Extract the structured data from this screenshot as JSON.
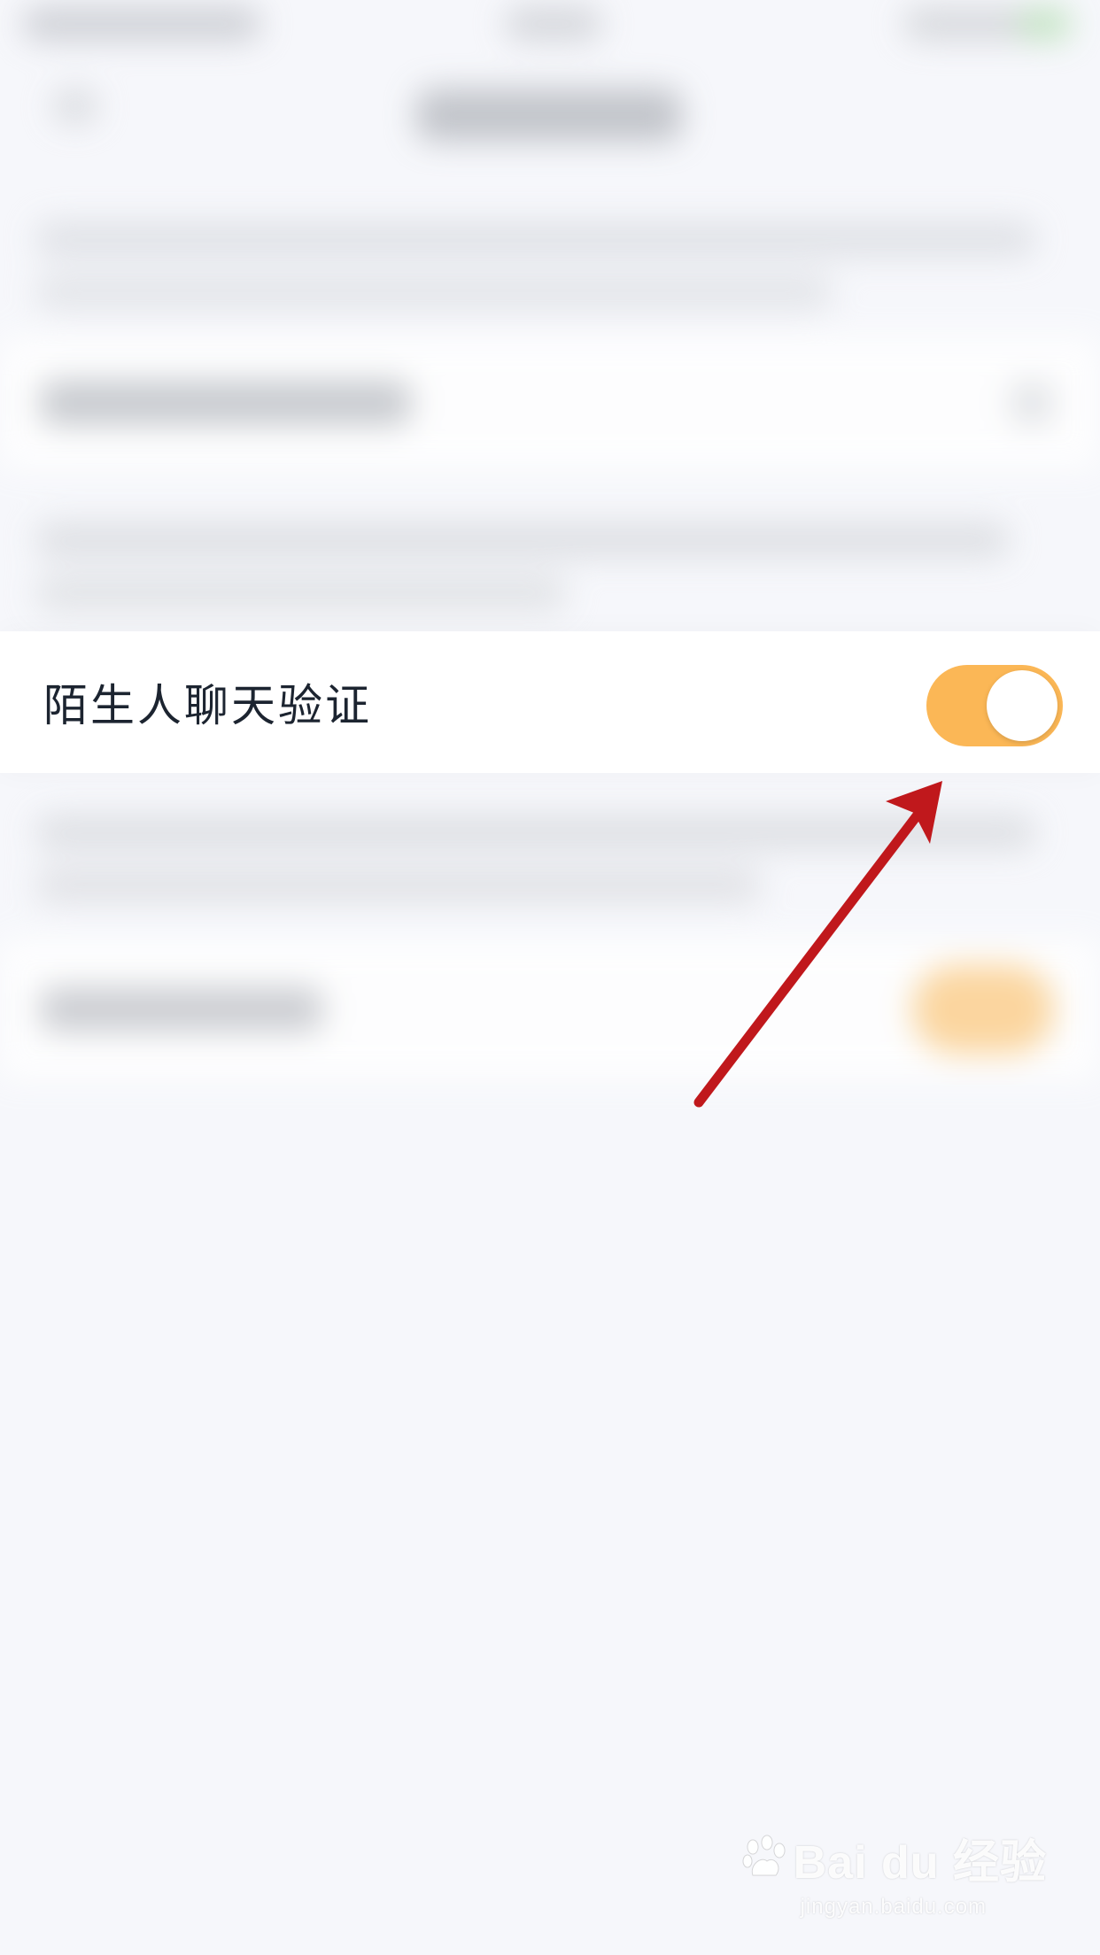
{
  "setting_row": {
    "label": "陌生人聊天验证",
    "toggle_on": true
  },
  "colors": {
    "toggle_active": "#fbb756",
    "annotation_arrow": "#c0181c",
    "background": "#f6f7fb"
  },
  "annotation": {
    "icon": "red-arrow-icon"
  },
  "watermark": {
    "brand": "Bai du 经验",
    "url": "jingyan.baidu.com",
    "icon": "baidu-paw-icon"
  }
}
